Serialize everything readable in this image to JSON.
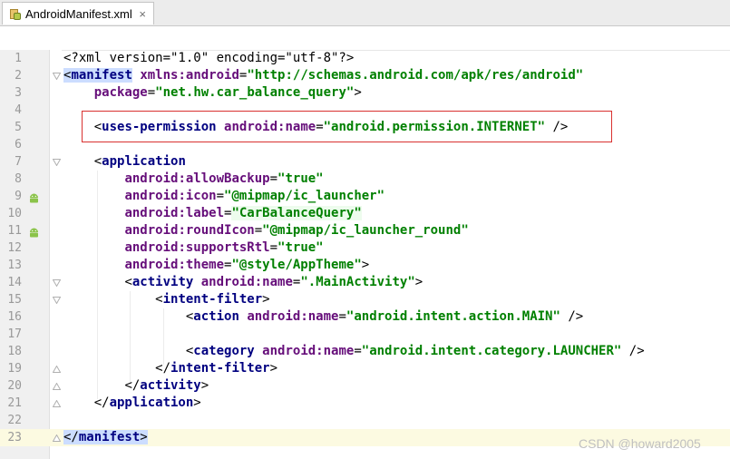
{
  "tab": {
    "title": "AndroidManifest.xml",
    "close": "×"
  },
  "line_numbers": [
    "1",
    "2",
    "3",
    "4",
    "5",
    "6",
    "7",
    "8",
    "9",
    "10",
    "11",
    "12",
    "13",
    "14",
    "15",
    "16",
    "17",
    "18",
    "19",
    "20",
    "21",
    "22",
    "23"
  ],
  "code": {
    "l1": {
      "a": "<?xml version=\"1.0\" encoding=\"utf-8\"?>"
    },
    "l2": {
      "lt": "<",
      "tag": "manifest",
      "sp": " ",
      "ns": "xmlns:android",
      "eq": "=",
      "val": "\"http://schemas.android.com/apk/res/android\""
    },
    "l3": {
      "ind": "    ",
      "attr": "package",
      "eq": "=",
      "val": "\"net.hw.car_balance_query\"",
      "end": ">"
    },
    "l5": {
      "ind": "    ",
      "lt": "<",
      "tag": "uses-permission",
      "sp": " ",
      "attr": "android:name",
      "eq": "=",
      "val": "\"android.permission.INTERNET\"",
      "end": " />"
    },
    "l7": {
      "ind": "    ",
      "lt": "<",
      "tag": "application"
    },
    "l8": {
      "ind": "        ",
      "attr": "android:allowBackup",
      "eq": "=",
      "val": "\"true\""
    },
    "l9": {
      "ind": "        ",
      "attr": "android:icon",
      "eq": "=",
      "val": "\"@mipmap/ic_launcher\""
    },
    "l10": {
      "ind": "        ",
      "attr": "android:label",
      "eq": "=",
      "val": "\"CarBalanceQuery\""
    },
    "l11": {
      "ind": "        ",
      "attr": "android:roundIcon",
      "eq": "=",
      "val": "\"@mipmap/ic_launcher_round\""
    },
    "l12": {
      "ind": "        ",
      "attr": "android:supportsRtl",
      "eq": "=",
      "val": "\"true\""
    },
    "l13": {
      "ind": "        ",
      "attr": "android:theme",
      "eq": "=",
      "val": "\"@style/AppTheme\"",
      "end": ">"
    },
    "l14": {
      "ind": "        ",
      "lt": "<",
      "tag": "activity",
      "sp": " ",
      "attr": "android:name",
      "eq": "=",
      "val": "\".MainActivity\"",
      "end": ">"
    },
    "l15": {
      "ind": "            ",
      "lt": "<",
      "tag": "intent-filter",
      "end": ">"
    },
    "l16": {
      "ind": "                ",
      "lt": "<",
      "tag": "action",
      "sp": " ",
      "attr": "android:name",
      "eq": "=",
      "val": "\"android.intent.action.MAIN\"",
      "end": " />"
    },
    "l18": {
      "ind": "                ",
      "lt": "<",
      "tag": "category",
      "sp": " ",
      "attr": "android:name",
      "eq": "=",
      "val": "\"android.intent.category.LAUNCHER\"",
      "end": " />"
    },
    "l19": {
      "ind": "            ",
      "lt": "</",
      "tag": "intent-filter",
      "end": ">"
    },
    "l20": {
      "ind": "        ",
      "lt": "</",
      "tag": "activity",
      "end": ">"
    },
    "l21": {
      "ind": "    ",
      "lt": "</",
      "tag": "application",
      "end": ">"
    },
    "l23": {
      "lt": "</",
      "tag": "manifest",
      "end": ">"
    }
  },
  "watermark": "CSDN @howard2005",
  "colors": {
    "tag": "#000080",
    "attribute": "#660e7a",
    "value": "#008000",
    "highlight_box": "#d9312f"
  }
}
